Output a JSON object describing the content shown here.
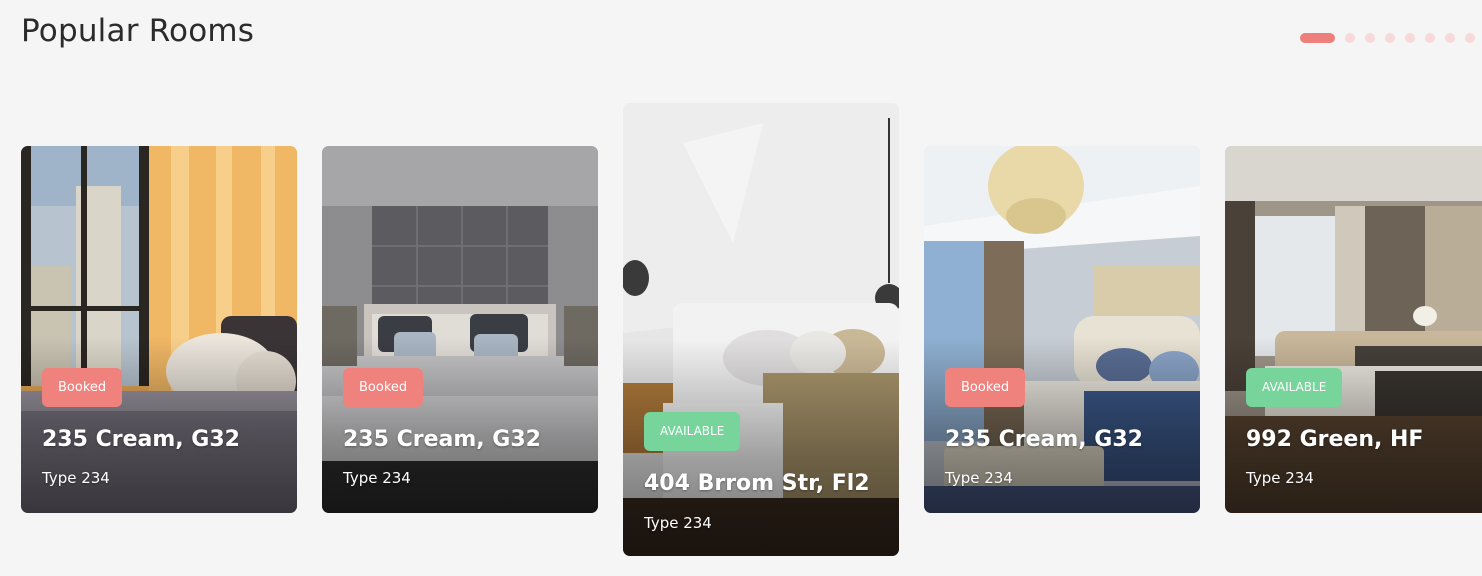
{
  "header": {
    "title": "Popular Rooms"
  },
  "pager": {
    "total": 8,
    "active_index": 0
  },
  "cards": [
    {
      "status": "Booked",
      "status_kind": "booked",
      "name": "235 Cream, G32",
      "type": "Type 234",
      "featured": false
    },
    {
      "status": "Booked",
      "status_kind": "booked",
      "name": "235 Cream, G32",
      "type": "Type 234",
      "featured": false
    },
    {
      "status": "AVAILABLE",
      "status_kind": "available",
      "name": "404 Brrom Str, Fl2",
      "type": "Type 234",
      "featured": true
    },
    {
      "status": "Booked",
      "status_kind": "booked",
      "name": "235 Cream, G32",
      "type": "Type 234",
      "featured": false
    },
    {
      "status": "AVAILABLE",
      "status_kind": "available",
      "name": "992 Green, HF",
      "type": "Type 234",
      "featured": false
    }
  ],
  "colors": {
    "booked": "#f0827e",
    "available": "#77d49b",
    "pager_active": "#ef7f7b",
    "pager_inactive": "#f6d9d8"
  }
}
